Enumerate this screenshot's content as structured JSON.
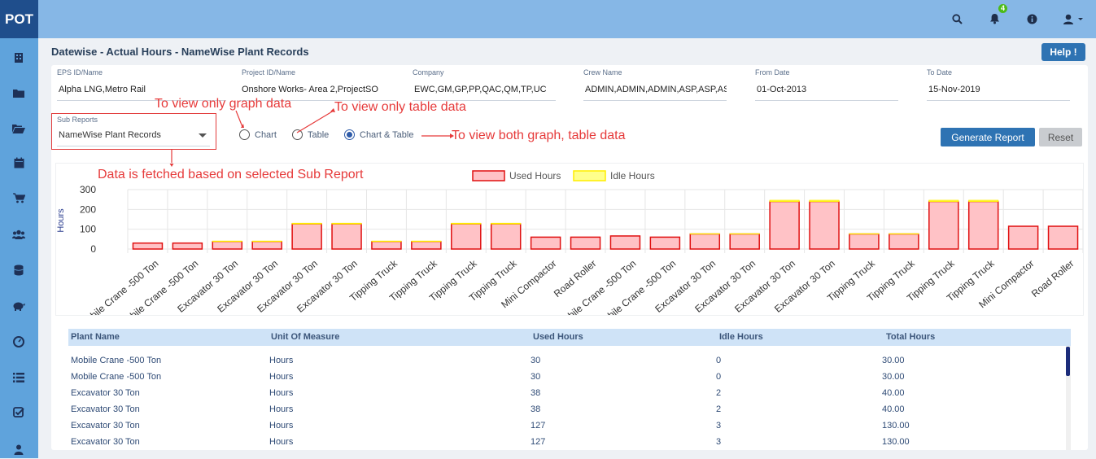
{
  "app": {
    "logo": "POT",
    "notification_count": "4"
  },
  "page": {
    "title": "Datewise - Actual Hours - NameWise Plant Records",
    "help_label": "Help !"
  },
  "filters": {
    "eps": {
      "label": "EPS ID/Name",
      "value": "Alpha LNG,Metro Rail"
    },
    "project": {
      "label": "Project ID/Name",
      "value": "Onshore  Works- Area 2,ProjectSO"
    },
    "company": {
      "label": "Company",
      "value": "EWC,GM,GP,PP,QAC,QM,TP,UC"
    },
    "crew": {
      "label": "Crew Name",
      "value": "ADMIN,ADMIN,ADMIN,ASP,ASP,AS"
    },
    "from": {
      "label": "From Date",
      "value": "01-Oct-2013"
    },
    "to": {
      "label": "To Date",
      "value": "15-Nov-2019"
    }
  },
  "sub_reports": {
    "label": "Sub Reports",
    "value": "NameWise Plant Records"
  },
  "view_options": {
    "chart": "Chart",
    "table": "Table",
    "both": "Chart & Table",
    "selected": "both"
  },
  "buttons": {
    "generate": "Generate Report",
    "reset": "Reset"
  },
  "annotations": {
    "graph": "To view only graph data",
    "table": "To view only table data",
    "both": "To view both graph, table data",
    "subreport": "Data is fetched based on selected Sub Report"
  },
  "chart_data": {
    "type": "bar",
    "ylabel": "Hours",
    "ylim": [
      0,
      300
    ],
    "yticks": [
      0,
      100,
      200,
      300
    ],
    "categories": [
      "Mobile Crane -500 Ton",
      "Mobile Crane -500 Ton",
      "Excavator 30 Ton",
      "Excavator 30 Ton",
      "Excavator 30 Ton",
      "Excavator 30 Ton",
      "Tipping Truck",
      "Tipping Truck",
      "Tipping Truck",
      "Tipping Truck",
      "Mini Compactor",
      "Road Roller",
      "Mobile Crane -500 Ton",
      "Mobile Crane -500 Ton",
      "Excavator 30 Ton",
      "Excavator 30 Ton",
      "Excavator 30 Ton",
      "Excavator 30 Ton",
      "Tipping Truck",
      "Tipping Truck",
      "Tipping Truck",
      "Tipping Truck",
      "Mini Compactor",
      "Road Roller"
    ],
    "series": [
      {
        "name": "Used Hours",
        "color": "#ffc2c6",
        "border": "#e01010",
        "values": [
          30,
          30,
          38,
          38,
          127,
          127,
          38,
          38,
          127,
          127,
          60,
          60,
          66,
          60,
          76,
          76,
          240,
          240,
          76,
          76,
          240,
          240,
          115,
          115
        ]
      },
      {
        "name": "Idle Hours",
        "color": "#ffff8c",
        "border": "#ffee00",
        "values": [
          0,
          0,
          2,
          2,
          3,
          3,
          2,
          2,
          3,
          3,
          0,
          0,
          0,
          0,
          1,
          1,
          6,
          6,
          1,
          1,
          6,
          6,
          0,
          0
        ]
      }
    ],
    "legend": "top-center"
  },
  "table": {
    "headers": [
      "Plant Name",
      "Unit Of Measure",
      "Used Hours",
      "Idle Hours",
      "Total Hours"
    ],
    "rows": [
      [
        "Mobile Crane -500 Ton",
        "Hours",
        "30",
        "0",
        "30.00"
      ],
      [
        "Mobile Crane -500 Ton",
        "Hours",
        "30",
        "0",
        "30.00"
      ],
      [
        "Excavator 30 Ton",
        "Hours",
        "38",
        "2",
        "40.00"
      ],
      [
        "Excavator 30 Ton",
        "Hours",
        "38",
        "2",
        "40.00"
      ],
      [
        "Excavator 30 Ton",
        "Hours",
        "127",
        "3",
        "130.00"
      ],
      [
        "Excavator 30 Ton",
        "Hours",
        "127",
        "3",
        "130.00"
      ]
    ]
  }
}
